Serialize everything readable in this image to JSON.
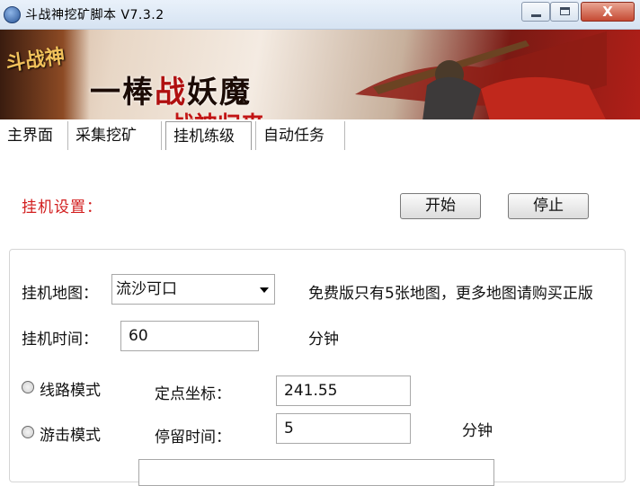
{
  "window": {
    "title": "斗战神挖矿脚本 V7.3.2",
    "close_symbol": "X"
  },
  "banner": {
    "logo_text": "斗战神",
    "headline_prefix": "一棒",
    "headline_red": "战",
    "headline_suffix": "妖魔",
    "subtitle": "战神归来"
  },
  "tabs": [
    {
      "label": "主界面",
      "selected": false
    },
    {
      "label": "采集挖矿",
      "selected": false
    },
    {
      "label": "挂机练级",
      "selected": true
    },
    {
      "label": "自动任务",
      "selected": false
    }
  ],
  "settings": {
    "section_title": "挂机设置：",
    "start_label": "开始",
    "stop_label": "停止",
    "map_label": "挂机地图：",
    "map_value": "流沙可口",
    "map_note": "免费版只有5张地图，更多地图请购买正版",
    "time_label": "挂机时间：",
    "time_value": "60",
    "time_unit": "分钟",
    "route_mode_label": "线路模式",
    "roam_mode_label": "游击模式",
    "fixed_point_label": "定点坐标：",
    "fixed_point_value": "241.55",
    "stay_time_label": "停留时间：",
    "stay_time_value": "5",
    "stay_time_unit": "分钟"
  },
  "colors": {
    "section_title": "#d21e1e",
    "close_button": "#c54a33"
  }
}
